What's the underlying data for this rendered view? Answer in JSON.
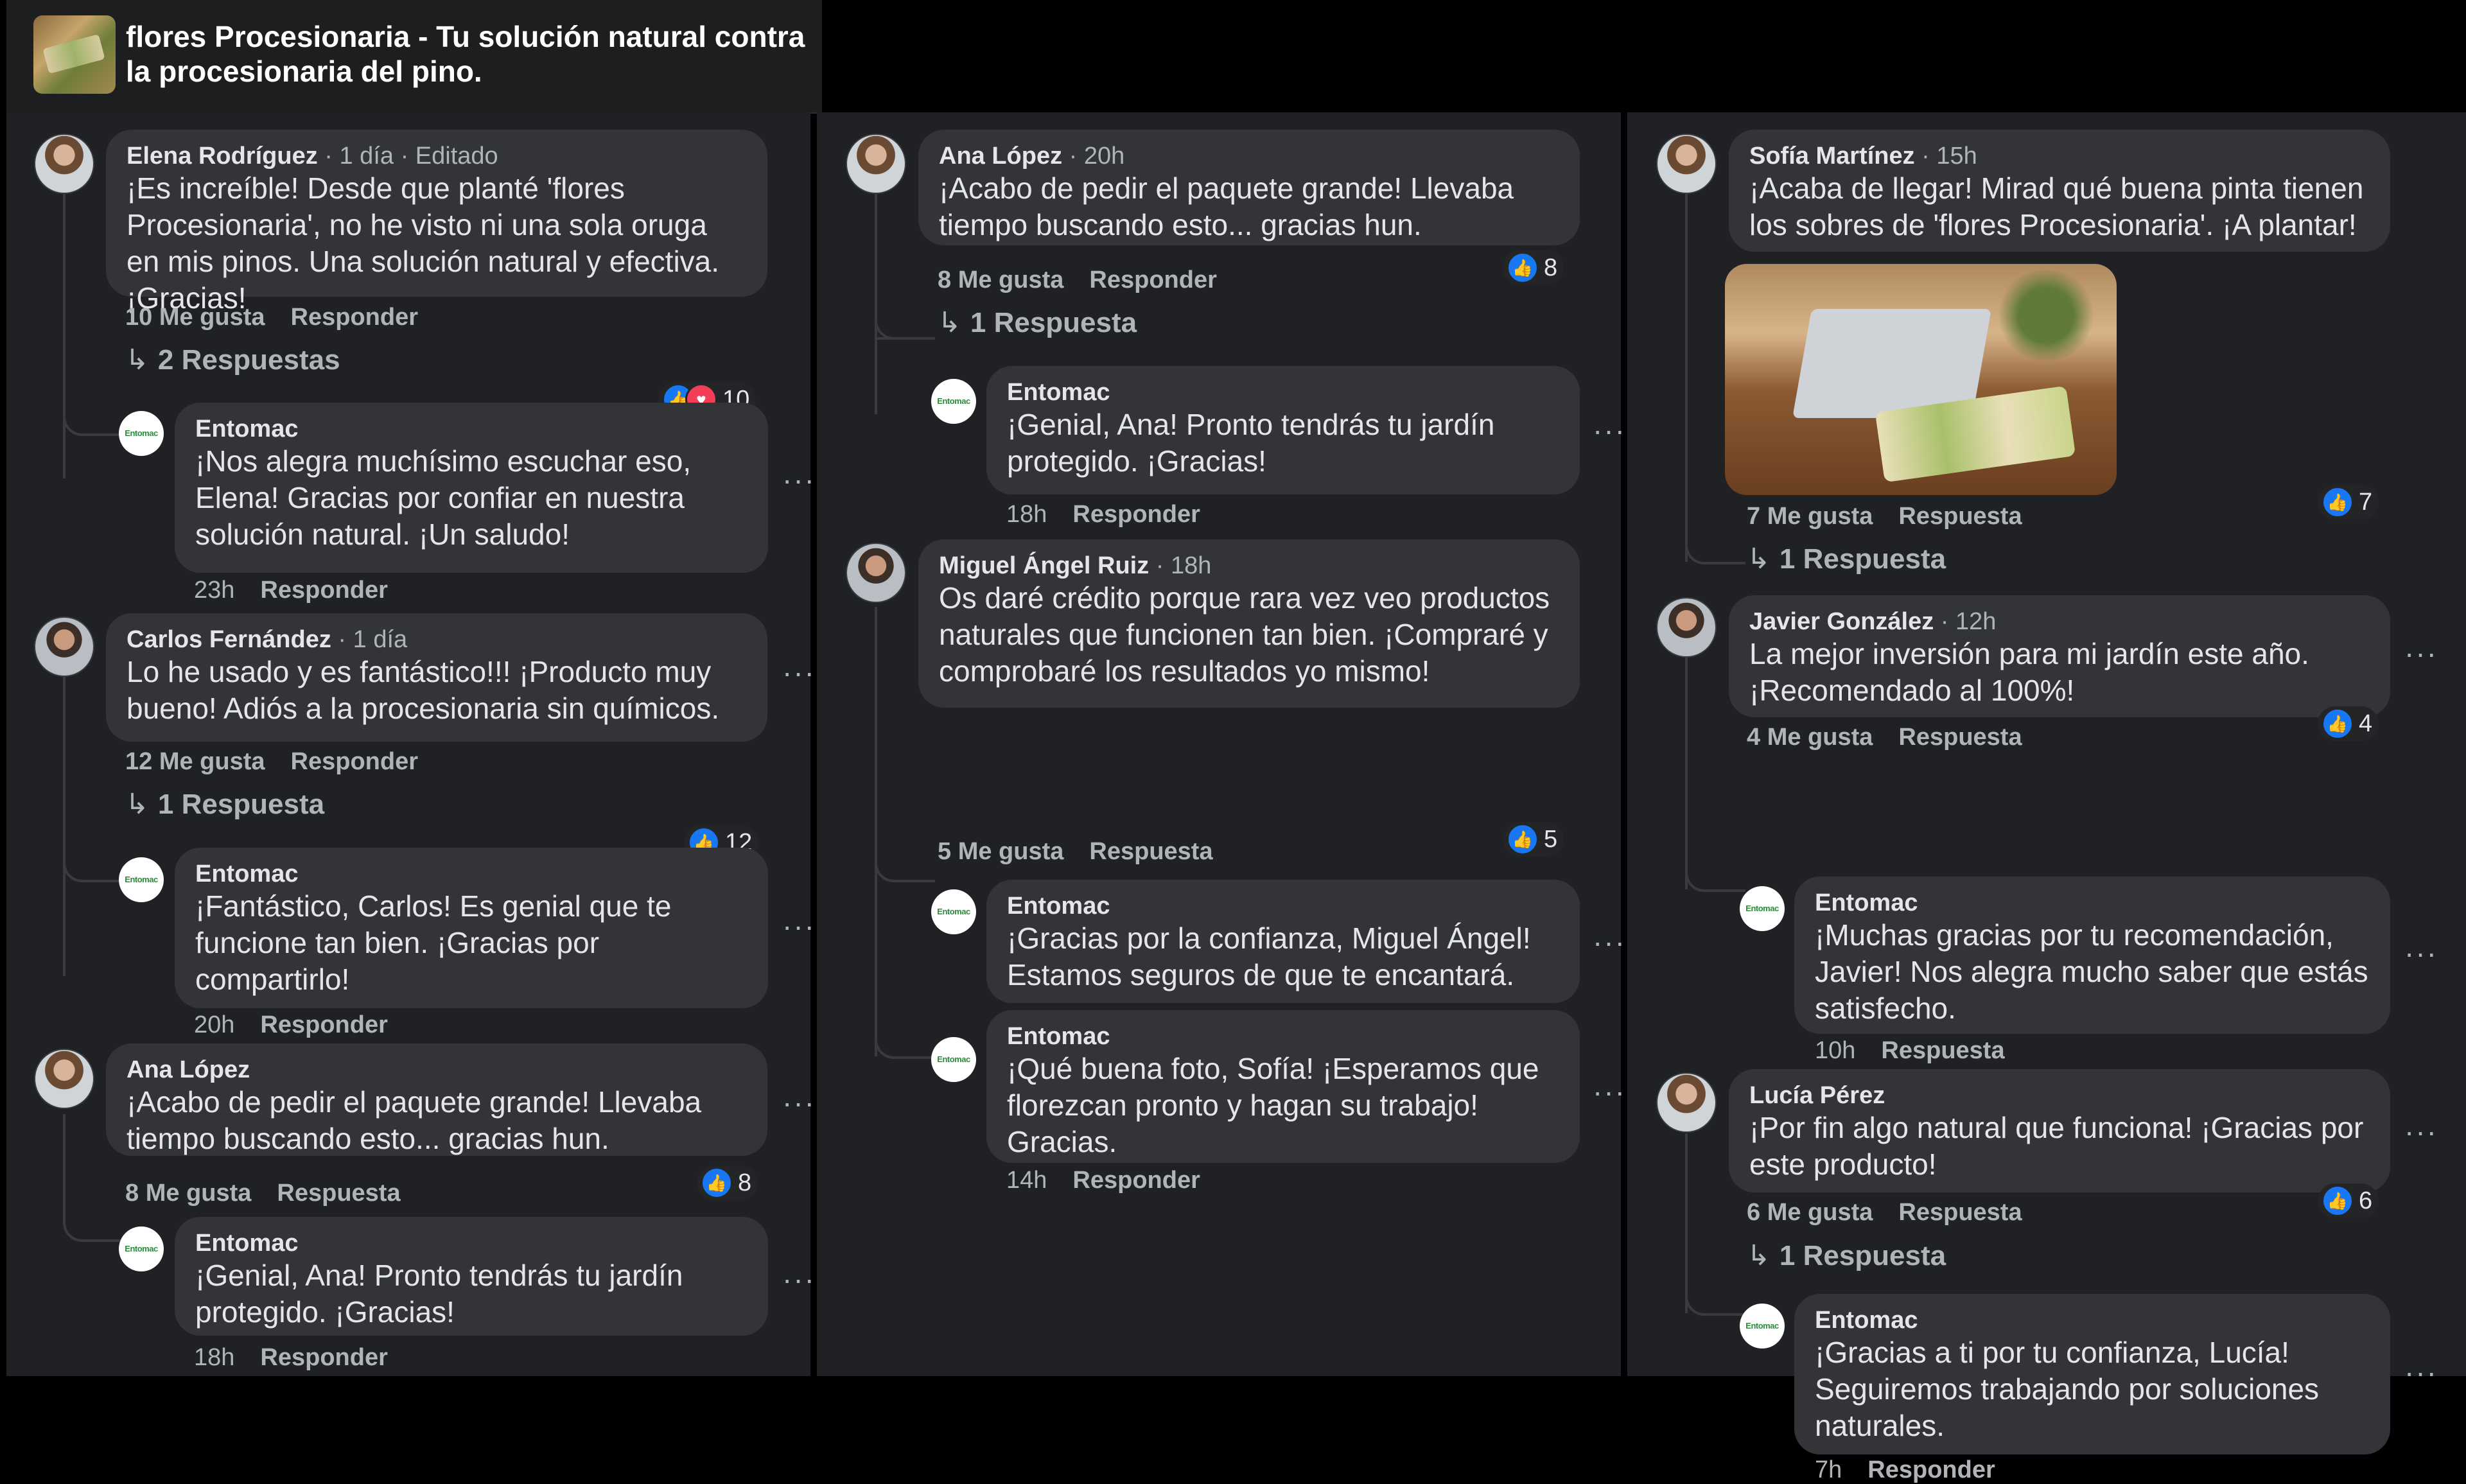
{
  "post": {
    "title": "flores Procesionaria - Tu solución natural contra la procesionaria del pino."
  },
  "brand": {
    "logo_text": "Entomac",
    "like_color": "#1877f2",
    "love_color": "#f33e58"
  },
  "col1": {
    "c1": {
      "name": "Elena Rodríguez",
      "meta": " · 1 día · Editado",
      "text": "¡Es increíble! Desde que planté 'flores Procesionaria', no he visto ni una sola oruga en mis pinos. Una solución natural y efectiva. ¡Gracias!",
      "likes": "10 Me gusta",
      "reply": "Responder",
      "reactions": "10",
      "replies": "2 Respuestas"
    },
    "r1": {
      "name": "Entomac",
      "text": "¡Nos alegra muchísimo escuchar eso, Elena! Gracias por confiar en nuestra solución natural. ¡Un saludo!",
      "time": "23h",
      "reply": "Responder"
    },
    "c2": {
      "name": "Carlos Fernández",
      "meta": " · 1 día",
      "text": "Lo he usado y es fantástico!!! ¡Producto muy bueno! Adiós a la procesionaria sin químicos.",
      "likes": "12 Me gusta",
      "reply": "Responder",
      "reactions": "12",
      "replies": "1 Respuesta"
    },
    "r2": {
      "name": "Entomac",
      "text": "¡Fantástico, Carlos! Es genial que te funcione tan bien. ¡Gracias por compartirlo!",
      "time": "20h",
      "reply": "Responder"
    },
    "c3": {
      "name": "Ana López",
      "meta": "",
      "text": "¡Acabo de pedir el paquete grande! Llevaba tiempo buscando esto... gracias hun.",
      "likes": "8 Me gusta",
      "reply": "Respuesta",
      "reactions": "8"
    },
    "r3": {
      "name": "Entomac",
      "text": "¡Genial, Ana! Pronto tendrás tu jardín protegido. ¡Gracias!",
      "time": "18h",
      "reply": "Responder"
    }
  },
  "col2": {
    "c1": {
      "name": "Ana López",
      "meta": " · 20h",
      "text": "¡Acabo de pedir el paquete grande! Llevaba tiempo buscando esto... gracias hun.",
      "likes": "8 Me gusta",
      "reply": "Responder",
      "reactions": "8",
      "replies": "1 Respuesta"
    },
    "r1": {
      "name": "Entomac",
      "text": "¡Genial, Ana! Pronto tendrás tu jardín protegido. ¡Gracias!",
      "time": "18h",
      "reply": "Responder"
    },
    "c2": {
      "name": "Miguel Ángel Ruiz",
      "meta": " · 18h",
      "text": "Os daré crédito porque rara vez veo productos naturales que funcionen tan bien. ¡Compraré y comprobaré los resultados yo mismo!",
      "likes": "5 Me gusta",
      "reply": "Respuesta",
      "reactions": "5"
    },
    "r2": {
      "name": "Entomac",
      "text": "¡Gracias por la confianza, Miguel Ángel! Estamos seguros de que te encantará."
    },
    "r3": {
      "name": "Entomac",
      "text": "¡Qué buena foto, Sofía! ¡Esperamos que florezcan pronto y hagan su trabajo! Gracias.",
      "time": "14h",
      "reply": "Responder"
    }
  },
  "col3": {
    "c1": {
      "name": "Sofía Martínez",
      "meta": " · 15h",
      "text": "¡Acaba de llegar! Mirad qué buena pinta tienen los sobres de 'flores Procesionaria'. ¡A plantar!",
      "likes": "7 Me gusta",
      "reply": "Respuesta",
      "reactions": "7",
      "replies": "1 Respuesta"
    },
    "c2": {
      "name": "Javier González",
      "meta": " · 12h",
      "text": "La mejor inversión para mi jardín este año. ¡Recomendado al 100%!",
      "likes": "4 Me gusta",
      "reply": "Respuesta",
      "reactions": "4"
    },
    "r2": {
      "name": "Entomac",
      "text": "¡Muchas gracias por tu recomendación, Javier! Nos alegra mucho saber que estás satisfecho.",
      "time": "10h",
      "reply": "Respuesta"
    },
    "c3": {
      "name": "Lucía Pérez",
      "meta": "",
      "text": "¡Por fin algo natural que funciona! ¡Gracias por este producto!",
      "likes": "6 Me gusta",
      "reply": "Respuesta",
      "reactions": "6",
      "replies": "1 Respuesta"
    },
    "r3": {
      "name": "Entomac",
      "text": "¡Gracias a ti por tu confianza, Lucía! Seguiremos trabajando por soluciones naturales.",
      "time": "7h",
      "reply": "Responder"
    }
  },
  "ui": {
    "more": "···",
    "reply_arrow": "↳",
    "like_glyph": "👍",
    "love_glyph": "♥"
  }
}
